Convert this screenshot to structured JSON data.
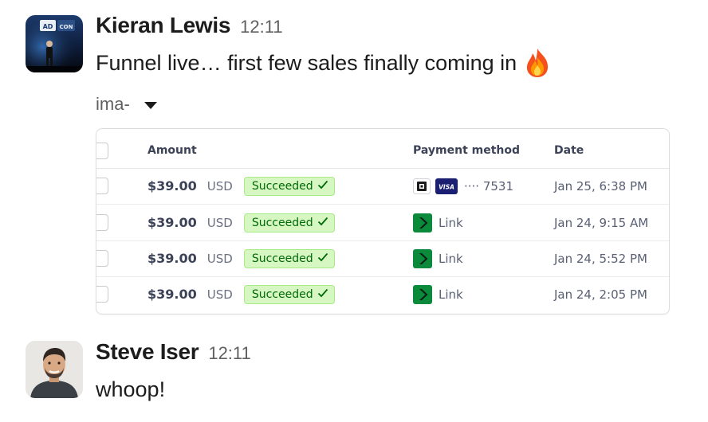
{
  "messages": [
    {
      "author": "Kieran Lewis",
      "time": "12:11",
      "text": "Funnel live… first few sales finally coming in",
      "emoji_icon": "fire-emoji",
      "avatar_badge": "AD",
      "avatar_badge_2": "CON",
      "attachment": {
        "name": "ima-",
        "toggle_icon": "caret-down-icon",
        "table": {
          "columns": [
            "Amount",
            "Payment method",
            "Date"
          ],
          "rows": [
            {
              "amount": "$39.00",
              "currency": "USD",
              "status": "Succeeded",
              "payment": "···· 7531",
              "payment_icons": [
                "apple-pay-icon",
                "visa-icon"
              ],
              "date": "Jan 25, 6:38 PM"
            },
            {
              "amount": "$39.00",
              "currency": "USD",
              "status": "Succeeded",
              "payment": "Link",
              "payment_icons": [
                "link-icon"
              ],
              "date": "Jan 24, 9:15 AM"
            },
            {
              "amount": "$39.00",
              "currency": "USD",
              "status": "Succeeded",
              "payment": "Link",
              "payment_icons": [
                "link-icon"
              ],
              "date": "Jan 24, 5:52 PM"
            },
            {
              "amount": "$39.00",
              "currency": "USD",
              "status": "Succeeded",
              "payment": "Link",
              "payment_icons": [
                "link-icon"
              ],
              "date": "Jan 24, 2:05 PM"
            }
          ]
        },
        "visa_label": "VISA"
      }
    },
    {
      "author": "Steve Iser",
      "time": "12:11",
      "text": "whoop!"
    }
  ],
  "colors": {
    "status_bg": "#d7f7c2",
    "status_text": "#006908",
    "link_green": "#0a8a3a",
    "visa_blue": "#1a1f71",
    "author_text": "#1d1c1d",
    "muted_text": "#616061"
  }
}
